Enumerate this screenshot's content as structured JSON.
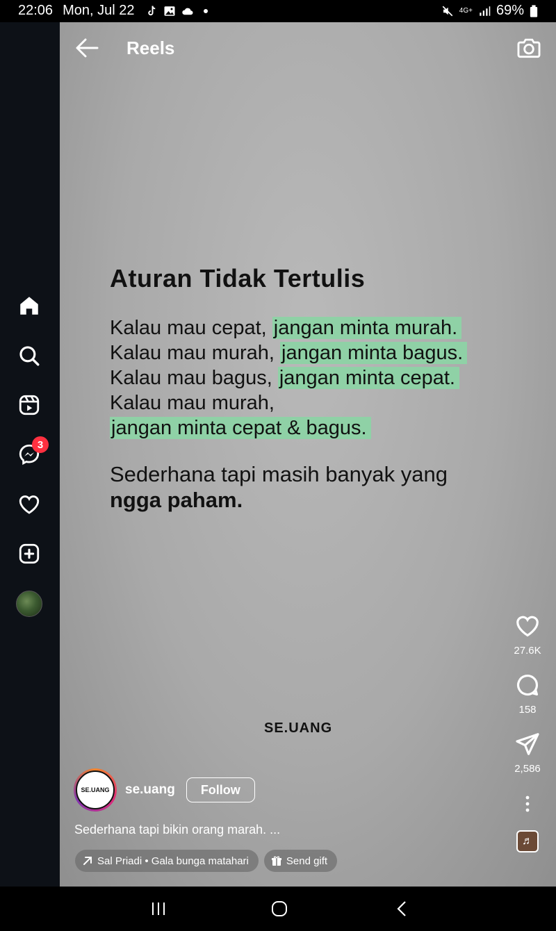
{
  "status_bar": {
    "time": "22:06",
    "date": "Mon, Jul 22",
    "notification_icons": [
      "tiktok-icon",
      "image-icon",
      "cloud-icon",
      "dot-icon"
    ],
    "battery": "69%",
    "network": "4G+",
    "system_icons": [
      "mute-icon",
      "network-4g-icon",
      "signal-icon",
      "battery-icon"
    ]
  },
  "sidebar": {
    "items": [
      {
        "name": "home",
        "icon": "home-icon"
      },
      {
        "name": "search",
        "icon": "search-icon"
      },
      {
        "name": "reels",
        "icon": "reels-icon"
      },
      {
        "name": "messages",
        "icon": "messenger-icon",
        "badge": "3"
      },
      {
        "name": "notifications",
        "icon": "heart-icon"
      },
      {
        "name": "create",
        "icon": "plus-square-icon"
      },
      {
        "name": "profile",
        "icon": "avatar"
      }
    ]
  },
  "header": {
    "title": "Reels",
    "back_icon": "arrow-left-icon",
    "camera_icon": "camera-icon"
  },
  "reel": {
    "title": "Aturan Tidak Tertulis",
    "lines": [
      {
        "plain": "Kalau mau cepat, ",
        "highlight": "jangan minta murah."
      },
      {
        "plain": "Kalau mau murah, ",
        "highlight": "jangan minta bagus."
      },
      {
        "plain": "Kalau mau bagus, ",
        "highlight": "jangan minta cepat."
      },
      {
        "plain": "Kalau mau murah,",
        "highlight": ""
      },
      {
        "plain": "",
        "highlight": "jangan minta cepat & bagus."
      }
    ],
    "footer": "Sederhana tapi masih banyak yang",
    "footer_bold": "ngga paham.",
    "brand": "SE.UANG",
    "highlight_color": "#8fd1a6"
  },
  "actions": {
    "likes": "27.6K",
    "comments": "158",
    "shares": "2,586"
  },
  "author": {
    "avatar_text": "SE.UANG",
    "username": "se.uang",
    "follow_label": "Follow"
  },
  "caption": "Sederhana tapi bikin orang marah. ...",
  "chips": {
    "audio": "Sal Priadi • Gala bunga matahari",
    "gift": "Send gift"
  },
  "nav_bar": [
    "recents-icon",
    "home-circle-icon",
    "back-chevron-icon"
  ]
}
